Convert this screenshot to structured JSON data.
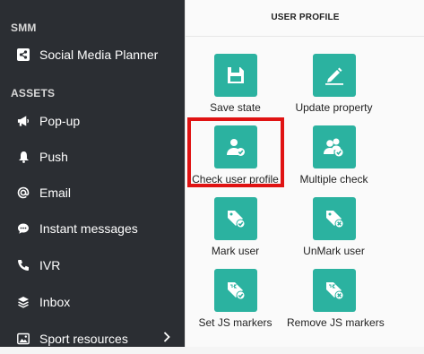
{
  "sidebar": {
    "sections": [
      {
        "label": "SMM",
        "items": [
          {
            "label": "Social Media Planner",
            "icon": "share-square-icon"
          }
        ]
      },
      {
        "label": "ASSETS",
        "items": [
          {
            "label": "Pop-up",
            "icon": "megaphone-icon"
          },
          {
            "label": "Push",
            "icon": "bell-icon"
          },
          {
            "label": "Email",
            "icon": "at-icon"
          },
          {
            "label": "Instant messages",
            "icon": "chat-bubble-icon"
          },
          {
            "label": "IVR",
            "icon": "phone-icon"
          },
          {
            "label": "Inbox",
            "icon": "layers-icon"
          },
          {
            "label": "Sport resources",
            "icon": "image-icon",
            "has_submenu": true
          }
        ]
      }
    ]
  },
  "panel": {
    "title": "USER PROFILE",
    "tiles": [
      {
        "label": "Save state",
        "icon": "floppy-disk-icon"
      },
      {
        "label": "Update property",
        "icon": "pencil-edit-icon"
      },
      {
        "label": "Check user profile",
        "icon": "user-check-icon",
        "highlighted": true
      },
      {
        "label": "Multiple check",
        "icon": "users-check-icon"
      },
      {
        "label": "Mark user",
        "icon": "tag-check-icon"
      },
      {
        "label": "UnMark user",
        "icon": "tag-x-icon"
      },
      {
        "label": "Set JS markers",
        "icon": "js-tag-check-icon"
      },
      {
        "label": "Remove JS markers",
        "icon": "js-tag-x-icon"
      }
    ]
  },
  "colors": {
    "sidebar_bg": "#2b2e33",
    "tile_bg": "#2bb2a0",
    "highlight": "#e01313"
  }
}
